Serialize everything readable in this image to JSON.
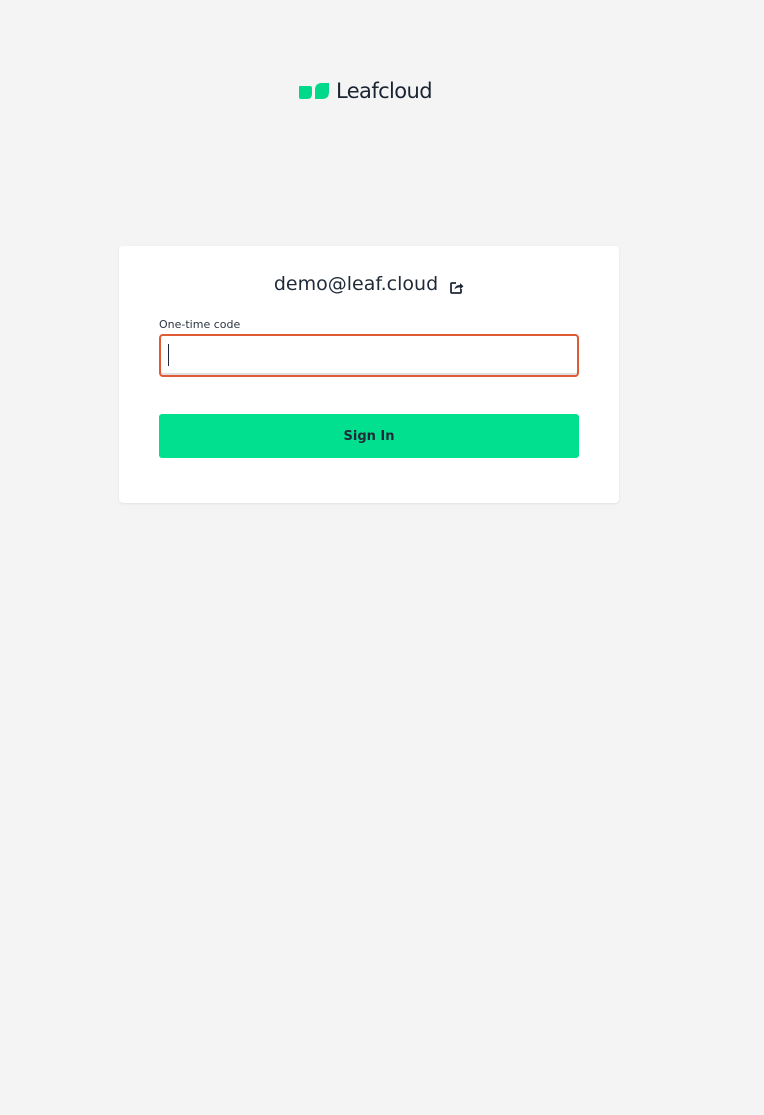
{
  "brand": {
    "name": "Leafcloud",
    "logo_icon": "leaf-logo-icon",
    "accent_color": "#00e08f"
  },
  "login": {
    "username": "demo@leaf.cloud",
    "change_user_icon": "share-arrow-icon",
    "otp_label": "One-time code",
    "otp_value": "",
    "submit_label": "Sign In",
    "error_border_color": "#e05a33"
  }
}
